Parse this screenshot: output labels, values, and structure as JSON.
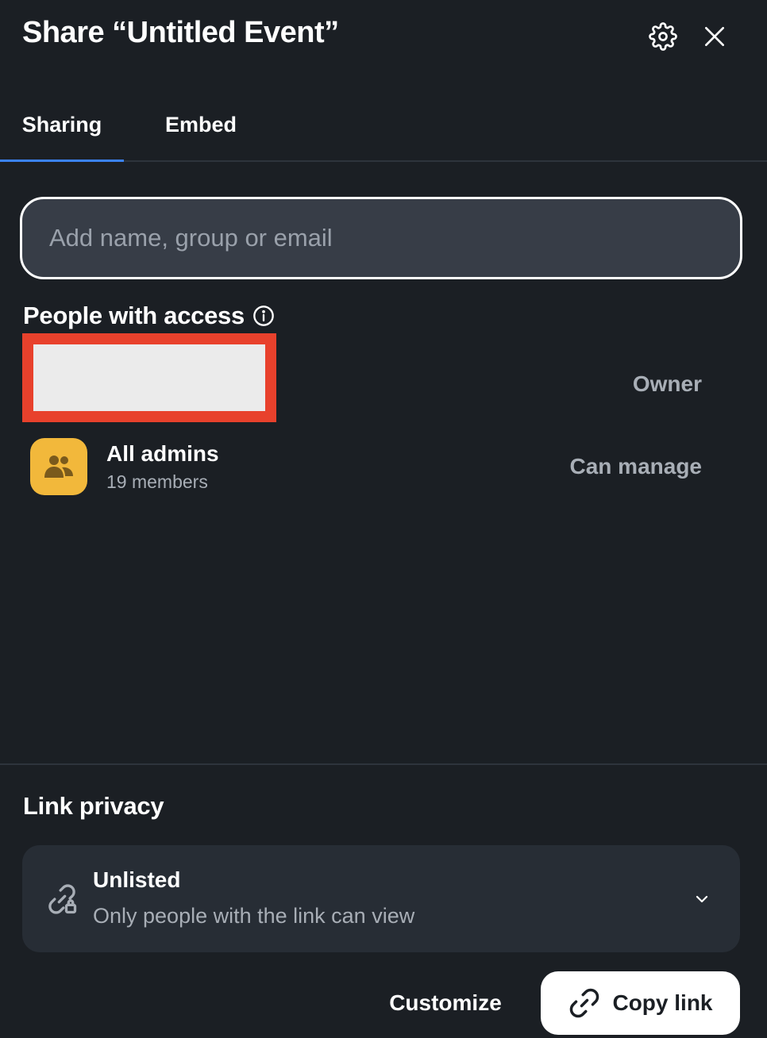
{
  "header": {
    "title": "Share “Untitled Event”"
  },
  "tabs": [
    {
      "label": "Sharing",
      "active": true
    },
    {
      "label": "Embed",
      "active": false
    }
  ],
  "search": {
    "placeholder": "Add name, group or email",
    "value": ""
  },
  "people": {
    "title": "People with access",
    "info_icon": "info-circle-icon",
    "entries": [
      {
        "name": "",
        "role": "Owner",
        "redacted": true
      },
      {
        "name": "All admins",
        "subtitle": "19 members",
        "role": "Can manage",
        "avatar_icon": "people-group-icon",
        "avatar_color": "#f2b83b"
      }
    ]
  },
  "link_privacy": {
    "title": "Link privacy",
    "option_label": "Unlisted",
    "option_description": "Only people with the link can view",
    "icon": "link-lock-icon"
  },
  "footer": {
    "customize_label": "Customize",
    "copy_link_label": "Copy link"
  },
  "colors": {
    "background": "#1b1f24",
    "tab_indicator": "#3b82f6",
    "card": "#272d35",
    "input_bg": "#373d47",
    "muted_text": "#a8aeb6",
    "redaction": "#e8412c"
  }
}
